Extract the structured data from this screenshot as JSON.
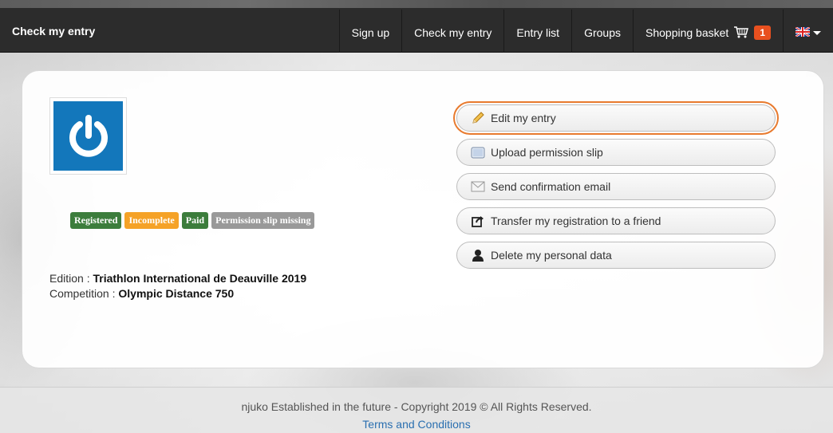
{
  "nav": {
    "brand": "Check my entry",
    "items": [
      "Sign up",
      "Check my entry",
      "Entry list",
      "Groups"
    ],
    "basket_label": "Shopping basket",
    "basket_count": "1"
  },
  "profile": {
    "statuses": [
      "Registered",
      "Incomplete",
      "Paid",
      "Permission slip missing"
    ],
    "edition_label": "Edition : ",
    "edition_value": "Triathlon International de Deauville 2019",
    "competition_label": "Competition : ",
    "competition_value": "Olympic Distance 750"
  },
  "actions": [
    {
      "label": "Edit my entry",
      "icon": "pencil-icon"
    },
    {
      "label": "Upload permission slip",
      "icon": "image-icon"
    },
    {
      "label": "Send confirmation email",
      "icon": "envelope-icon"
    },
    {
      "label": "Transfer my registration to a friend",
      "icon": "share-icon"
    },
    {
      "label": "Delete my personal data",
      "icon": "user-icon"
    }
  ],
  "footer": {
    "copyright": "njuko Established in the future - Copyright 2019 © All Rights Reserved.",
    "terms": "Terms and Conditions"
  },
  "colors": {
    "nav_bg": "#2c2c2c",
    "logo_blue": "#1377bb",
    "registered": "#3c7d3c",
    "incomplete": "#f5a227",
    "paid": "#3c7d3c",
    "missing": "#999999",
    "highlight": "#e87a2e",
    "basket_badge": "#e8501f"
  }
}
